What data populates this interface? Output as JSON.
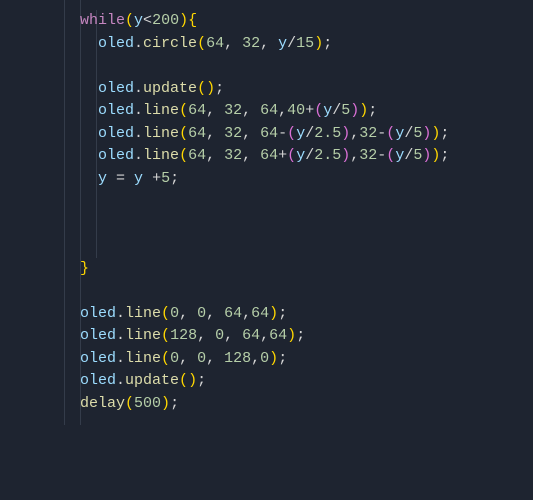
{
  "code": {
    "lines": [
      {
        "tokens": [
          {
            "t": "while",
            "c": "kw"
          },
          {
            "t": "(",
            "c": "paren"
          },
          {
            "t": "y",
            "c": "var"
          },
          {
            "t": "<",
            "c": "op"
          },
          {
            "t": "200",
            "c": "num"
          },
          {
            "t": ")",
            "c": "paren"
          },
          {
            "t": "{",
            "c": "curly"
          }
        ],
        "indent": 0
      },
      {
        "tokens": [
          {
            "t": "oled",
            "c": "obj"
          },
          {
            "t": ".",
            "c": "punc"
          },
          {
            "t": "circle",
            "c": "fn"
          },
          {
            "t": "(",
            "c": "paren"
          },
          {
            "t": "64",
            "c": "num"
          },
          {
            "t": ", ",
            "c": "punc"
          },
          {
            "t": "32",
            "c": "num"
          },
          {
            "t": ", ",
            "c": "punc"
          },
          {
            "t": "y",
            "c": "var"
          },
          {
            "t": "/",
            "c": "op"
          },
          {
            "t": "15",
            "c": "num"
          },
          {
            "t": ")",
            "c": "paren"
          },
          {
            "t": ";",
            "c": "punc"
          }
        ],
        "indent": 1
      },
      {
        "tokens": [],
        "indent": 1
      },
      {
        "tokens": [
          {
            "t": "oled",
            "c": "obj"
          },
          {
            "t": ".",
            "c": "punc"
          },
          {
            "t": "update",
            "c": "fn"
          },
          {
            "t": "(",
            "c": "paren"
          },
          {
            "t": ")",
            "c": "paren"
          },
          {
            "t": ";",
            "c": "punc"
          }
        ],
        "indent": 1
      },
      {
        "tokens": [
          {
            "t": "oled",
            "c": "obj"
          },
          {
            "t": ".",
            "c": "punc"
          },
          {
            "t": "line",
            "c": "fn"
          },
          {
            "t": "(",
            "c": "paren"
          },
          {
            "t": "64",
            "c": "num"
          },
          {
            "t": ", ",
            "c": "punc"
          },
          {
            "t": "32",
            "c": "num"
          },
          {
            "t": ", ",
            "c": "punc"
          },
          {
            "t": "64",
            "c": "num"
          },
          {
            "t": ",",
            "c": "punc"
          },
          {
            "t": "40",
            "c": "num"
          },
          {
            "t": "+",
            "c": "op"
          },
          {
            "t": "(",
            "c": "paren2"
          },
          {
            "t": "y",
            "c": "var"
          },
          {
            "t": "/",
            "c": "op"
          },
          {
            "t": "5",
            "c": "num"
          },
          {
            "t": ")",
            "c": "paren2"
          },
          {
            "t": ")",
            "c": "paren"
          },
          {
            "t": ";",
            "c": "punc"
          }
        ],
        "indent": 1
      },
      {
        "tokens": [
          {
            "t": "oled",
            "c": "obj"
          },
          {
            "t": ".",
            "c": "punc"
          },
          {
            "t": "line",
            "c": "fn"
          },
          {
            "t": "(",
            "c": "paren"
          },
          {
            "t": "64",
            "c": "num"
          },
          {
            "t": ", ",
            "c": "punc"
          },
          {
            "t": "32",
            "c": "num"
          },
          {
            "t": ", ",
            "c": "punc"
          },
          {
            "t": "64",
            "c": "num"
          },
          {
            "t": "-",
            "c": "op"
          },
          {
            "t": "(",
            "c": "paren2"
          },
          {
            "t": "y",
            "c": "var"
          },
          {
            "t": "/",
            "c": "op"
          },
          {
            "t": "2.5",
            "c": "num"
          },
          {
            "t": ")",
            "c": "paren2"
          },
          {
            "t": ",",
            "c": "punc"
          },
          {
            "t": "32",
            "c": "num"
          },
          {
            "t": "-",
            "c": "op"
          },
          {
            "t": "(",
            "c": "paren2"
          },
          {
            "t": "y",
            "c": "var"
          },
          {
            "t": "/",
            "c": "op"
          },
          {
            "t": "5",
            "c": "num"
          },
          {
            "t": ")",
            "c": "paren2"
          },
          {
            "t": ")",
            "c": "paren"
          },
          {
            "t": ";",
            "c": "punc"
          }
        ],
        "indent": 1
      },
      {
        "tokens": [
          {
            "t": "oled",
            "c": "obj"
          },
          {
            "t": ".",
            "c": "punc"
          },
          {
            "t": "line",
            "c": "fn"
          },
          {
            "t": "(",
            "c": "paren"
          },
          {
            "t": "64",
            "c": "num"
          },
          {
            "t": ", ",
            "c": "punc"
          },
          {
            "t": "32",
            "c": "num"
          },
          {
            "t": ", ",
            "c": "punc"
          },
          {
            "t": "64",
            "c": "num"
          },
          {
            "t": "+",
            "c": "op"
          },
          {
            "t": "(",
            "c": "paren2"
          },
          {
            "t": "y",
            "c": "var"
          },
          {
            "t": "/",
            "c": "op"
          },
          {
            "t": "2.5",
            "c": "num"
          },
          {
            "t": ")",
            "c": "paren2"
          },
          {
            "t": ",",
            "c": "punc"
          },
          {
            "t": "32",
            "c": "num"
          },
          {
            "t": "-",
            "c": "op"
          },
          {
            "t": "(",
            "c": "paren2"
          },
          {
            "t": "y",
            "c": "var"
          },
          {
            "t": "/",
            "c": "op"
          },
          {
            "t": "5",
            "c": "num"
          },
          {
            "t": ")",
            "c": "paren2"
          },
          {
            "t": ")",
            "c": "paren"
          },
          {
            "t": ";",
            "c": "punc"
          }
        ],
        "indent": 1
      },
      {
        "tokens": [
          {
            "t": "y",
            "c": "var"
          },
          {
            "t": " = ",
            "c": "op"
          },
          {
            "t": "y",
            "c": "var"
          },
          {
            "t": " +",
            "c": "op"
          },
          {
            "t": "5",
            "c": "num"
          },
          {
            "t": ";",
            "c": "punc"
          }
        ],
        "indent": 1
      },
      {
        "tokens": [],
        "indent": 1
      },
      {
        "tokens": [],
        "indent": 1
      },
      {
        "tokens": [],
        "indent": 1
      },
      {
        "tokens": [
          {
            "t": "}",
            "c": "curly"
          }
        ],
        "indent": 0
      },
      {
        "tokens": [],
        "indent": 0
      },
      {
        "tokens": [
          {
            "t": "oled",
            "c": "obj"
          },
          {
            "t": ".",
            "c": "punc"
          },
          {
            "t": "line",
            "c": "fn"
          },
          {
            "t": "(",
            "c": "paren"
          },
          {
            "t": "0",
            "c": "num"
          },
          {
            "t": ", ",
            "c": "punc"
          },
          {
            "t": "0",
            "c": "num"
          },
          {
            "t": ", ",
            "c": "punc"
          },
          {
            "t": "64",
            "c": "num"
          },
          {
            "t": ",",
            "c": "punc"
          },
          {
            "t": "64",
            "c": "num"
          },
          {
            "t": ")",
            "c": "paren"
          },
          {
            "t": ";",
            "c": "punc"
          }
        ],
        "indent": 0
      },
      {
        "tokens": [
          {
            "t": "oled",
            "c": "obj"
          },
          {
            "t": ".",
            "c": "punc"
          },
          {
            "t": "line",
            "c": "fn"
          },
          {
            "t": "(",
            "c": "paren"
          },
          {
            "t": "128",
            "c": "num"
          },
          {
            "t": ", ",
            "c": "punc"
          },
          {
            "t": "0",
            "c": "num"
          },
          {
            "t": ", ",
            "c": "punc"
          },
          {
            "t": "64",
            "c": "num"
          },
          {
            "t": ",",
            "c": "punc"
          },
          {
            "t": "64",
            "c": "num"
          },
          {
            "t": ")",
            "c": "paren"
          },
          {
            "t": ";",
            "c": "punc"
          }
        ],
        "indent": 0
      },
      {
        "tokens": [
          {
            "t": "oled",
            "c": "obj"
          },
          {
            "t": ".",
            "c": "punc"
          },
          {
            "t": "line",
            "c": "fn"
          },
          {
            "t": "(",
            "c": "paren"
          },
          {
            "t": "0",
            "c": "num"
          },
          {
            "t": ", ",
            "c": "punc"
          },
          {
            "t": "0",
            "c": "num"
          },
          {
            "t": ", ",
            "c": "punc"
          },
          {
            "t": "128",
            "c": "num"
          },
          {
            "t": ",",
            "c": "punc"
          },
          {
            "t": "0",
            "c": "num"
          },
          {
            "t": ")",
            "c": "paren"
          },
          {
            "t": ";",
            "c": "punc"
          }
        ],
        "indent": 0
      },
      {
        "tokens": [
          {
            "t": "oled",
            "c": "obj"
          },
          {
            "t": ".",
            "c": "punc"
          },
          {
            "t": "update",
            "c": "fn"
          },
          {
            "t": "(",
            "c": "paren"
          },
          {
            "t": ")",
            "c": "paren"
          },
          {
            "t": ";",
            "c": "punc"
          }
        ],
        "indent": 0
      },
      {
        "tokens": [
          {
            "t": "delay",
            "c": "fn"
          },
          {
            "t": "(",
            "c": "paren"
          },
          {
            "t": "500",
            "c": "num"
          },
          {
            "t": ")",
            "c": "paren"
          },
          {
            "t": ";",
            "c": "punc"
          }
        ],
        "indent": 0
      }
    ]
  }
}
